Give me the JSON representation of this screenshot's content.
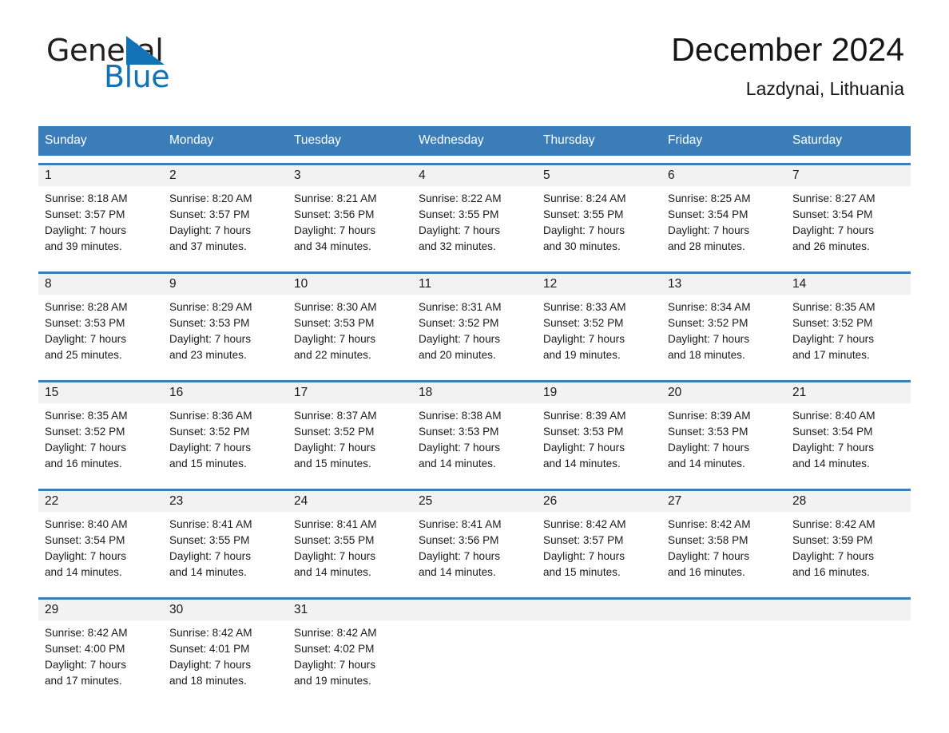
{
  "brand": {
    "name_part1": "General",
    "name_part2": "Blue",
    "triangle_color": "#1272b6"
  },
  "header": {
    "title": "December 2024",
    "subtitle": "Lazdynai, Lithuania"
  },
  "theme": {
    "header_blue": "#3b7db8",
    "day_band_gray": "#f2f2f2",
    "text": "#1a1a1a"
  },
  "weekdays": [
    "Sunday",
    "Monday",
    "Tuesday",
    "Wednesday",
    "Thursday",
    "Friday",
    "Saturday"
  ],
  "weeks": [
    [
      {
        "day": "1",
        "sunrise": "Sunrise: 8:18 AM",
        "sunset": "Sunset: 3:57 PM",
        "daylight1": "Daylight: 7 hours",
        "daylight2": "and 39 minutes."
      },
      {
        "day": "2",
        "sunrise": "Sunrise: 8:20 AM",
        "sunset": "Sunset: 3:57 PM",
        "daylight1": "Daylight: 7 hours",
        "daylight2": "and 37 minutes."
      },
      {
        "day": "3",
        "sunrise": "Sunrise: 8:21 AM",
        "sunset": "Sunset: 3:56 PM",
        "daylight1": "Daylight: 7 hours",
        "daylight2": "and 34 minutes."
      },
      {
        "day": "4",
        "sunrise": "Sunrise: 8:22 AM",
        "sunset": "Sunset: 3:55 PM",
        "daylight1": "Daylight: 7 hours",
        "daylight2": "and 32 minutes."
      },
      {
        "day": "5",
        "sunrise": "Sunrise: 8:24 AM",
        "sunset": "Sunset: 3:55 PM",
        "daylight1": "Daylight: 7 hours",
        "daylight2": "and 30 minutes."
      },
      {
        "day": "6",
        "sunrise": "Sunrise: 8:25 AM",
        "sunset": "Sunset: 3:54 PM",
        "daylight1": "Daylight: 7 hours",
        "daylight2": "and 28 minutes."
      },
      {
        "day": "7",
        "sunrise": "Sunrise: 8:27 AM",
        "sunset": "Sunset: 3:54 PM",
        "daylight1": "Daylight: 7 hours",
        "daylight2": "and 26 minutes."
      }
    ],
    [
      {
        "day": "8",
        "sunrise": "Sunrise: 8:28 AM",
        "sunset": "Sunset: 3:53 PM",
        "daylight1": "Daylight: 7 hours",
        "daylight2": "and 25 minutes."
      },
      {
        "day": "9",
        "sunrise": "Sunrise: 8:29 AM",
        "sunset": "Sunset: 3:53 PM",
        "daylight1": "Daylight: 7 hours",
        "daylight2": "and 23 minutes."
      },
      {
        "day": "10",
        "sunrise": "Sunrise: 8:30 AM",
        "sunset": "Sunset: 3:53 PM",
        "daylight1": "Daylight: 7 hours",
        "daylight2": "and 22 minutes."
      },
      {
        "day": "11",
        "sunrise": "Sunrise: 8:31 AM",
        "sunset": "Sunset: 3:52 PM",
        "daylight1": "Daylight: 7 hours",
        "daylight2": "and 20 minutes."
      },
      {
        "day": "12",
        "sunrise": "Sunrise: 8:33 AM",
        "sunset": "Sunset: 3:52 PM",
        "daylight1": "Daylight: 7 hours",
        "daylight2": "and 19 minutes."
      },
      {
        "day": "13",
        "sunrise": "Sunrise: 8:34 AM",
        "sunset": "Sunset: 3:52 PM",
        "daylight1": "Daylight: 7 hours",
        "daylight2": "and 18 minutes."
      },
      {
        "day": "14",
        "sunrise": "Sunrise: 8:35 AM",
        "sunset": "Sunset: 3:52 PM",
        "daylight1": "Daylight: 7 hours",
        "daylight2": "and 17 minutes."
      }
    ],
    [
      {
        "day": "15",
        "sunrise": "Sunrise: 8:35 AM",
        "sunset": "Sunset: 3:52 PM",
        "daylight1": "Daylight: 7 hours",
        "daylight2": "and 16 minutes."
      },
      {
        "day": "16",
        "sunrise": "Sunrise: 8:36 AM",
        "sunset": "Sunset: 3:52 PM",
        "daylight1": "Daylight: 7 hours",
        "daylight2": "and 15 minutes."
      },
      {
        "day": "17",
        "sunrise": "Sunrise: 8:37 AM",
        "sunset": "Sunset: 3:52 PM",
        "daylight1": "Daylight: 7 hours",
        "daylight2": "and 15 minutes."
      },
      {
        "day": "18",
        "sunrise": "Sunrise: 8:38 AM",
        "sunset": "Sunset: 3:53 PM",
        "daylight1": "Daylight: 7 hours",
        "daylight2": "and 14 minutes."
      },
      {
        "day": "19",
        "sunrise": "Sunrise: 8:39 AM",
        "sunset": "Sunset: 3:53 PM",
        "daylight1": "Daylight: 7 hours",
        "daylight2": "and 14 minutes."
      },
      {
        "day": "20",
        "sunrise": "Sunrise: 8:39 AM",
        "sunset": "Sunset: 3:53 PM",
        "daylight1": "Daylight: 7 hours",
        "daylight2": "and 14 minutes."
      },
      {
        "day": "21",
        "sunrise": "Sunrise: 8:40 AM",
        "sunset": "Sunset: 3:54 PM",
        "daylight1": "Daylight: 7 hours",
        "daylight2": "and 14 minutes."
      }
    ],
    [
      {
        "day": "22",
        "sunrise": "Sunrise: 8:40 AM",
        "sunset": "Sunset: 3:54 PM",
        "daylight1": "Daylight: 7 hours",
        "daylight2": "and 14 minutes."
      },
      {
        "day": "23",
        "sunrise": "Sunrise: 8:41 AM",
        "sunset": "Sunset: 3:55 PM",
        "daylight1": "Daylight: 7 hours",
        "daylight2": "and 14 minutes."
      },
      {
        "day": "24",
        "sunrise": "Sunrise: 8:41 AM",
        "sunset": "Sunset: 3:55 PM",
        "daylight1": "Daylight: 7 hours",
        "daylight2": "and 14 minutes."
      },
      {
        "day": "25",
        "sunrise": "Sunrise: 8:41 AM",
        "sunset": "Sunset: 3:56 PM",
        "daylight1": "Daylight: 7 hours",
        "daylight2": "and 14 minutes."
      },
      {
        "day": "26",
        "sunrise": "Sunrise: 8:42 AM",
        "sunset": "Sunset: 3:57 PM",
        "daylight1": "Daylight: 7 hours",
        "daylight2": "and 15 minutes."
      },
      {
        "day": "27",
        "sunrise": "Sunrise: 8:42 AM",
        "sunset": "Sunset: 3:58 PM",
        "daylight1": "Daylight: 7 hours",
        "daylight2": "and 16 minutes."
      },
      {
        "day": "28",
        "sunrise": "Sunrise: 8:42 AM",
        "sunset": "Sunset: 3:59 PM",
        "daylight1": "Daylight: 7 hours",
        "daylight2": "and 16 minutes."
      }
    ],
    [
      {
        "day": "29",
        "sunrise": "Sunrise: 8:42 AM",
        "sunset": "Sunset: 4:00 PM",
        "daylight1": "Daylight: 7 hours",
        "daylight2": "and 17 minutes."
      },
      {
        "day": "30",
        "sunrise": "Sunrise: 8:42 AM",
        "sunset": "Sunset: 4:01 PM",
        "daylight1": "Daylight: 7 hours",
        "daylight2": "and 18 minutes."
      },
      {
        "day": "31",
        "sunrise": "Sunrise: 8:42 AM",
        "sunset": "Sunset: 4:02 PM",
        "daylight1": "Daylight: 7 hours",
        "daylight2": "and 19 minutes."
      },
      {
        "day": "",
        "sunrise": "",
        "sunset": "",
        "daylight1": "",
        "daylight2": ""
      },
      {
        "day": "",
        "sunrise": "",
        "sunset": "",
        "daylight1": "",
        "daylight2": ""
      },
      {
        "day": "",
        "sunrise": "",
        "sunset": "",
        "daylight1": "",
        "daylight2": ""
      },
      {
        "day": "",
        "sunrise": "",
        "sunset": "",
        "daylight1": "",
        "daylight2": ""
      }
    ]
  ]
}
